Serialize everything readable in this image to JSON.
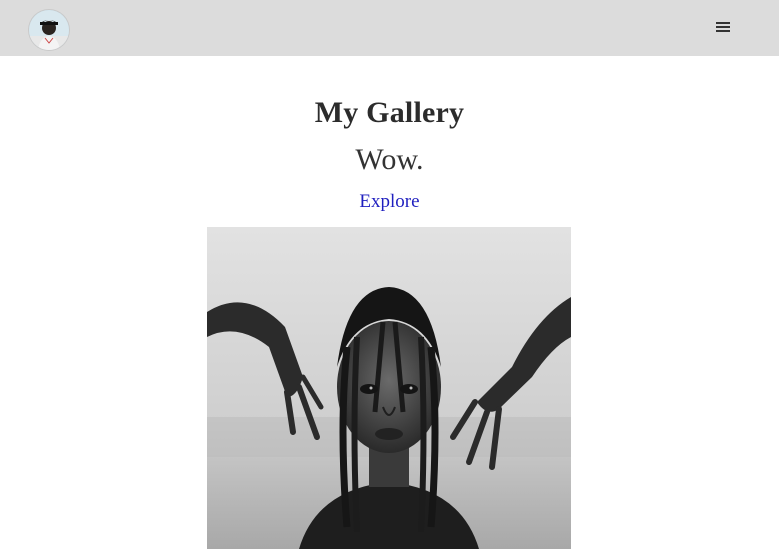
{
  "header": {
    "avatar_icon": "profile-avatar",
    "menu_icon": "hamburger-menu-icon"
  },
  "main": {
    "title": "My Gallery",
    "subtitle": "Wow.",
    "explore_link": "Explore",
    "featured_image_icon": "portrait-photo"
  },
  "colors": {
    "topbar_bg": "#dcdcdc",
    "link": "#1f1fbf",
    "heading": "#2c2c2c"
  }
}
